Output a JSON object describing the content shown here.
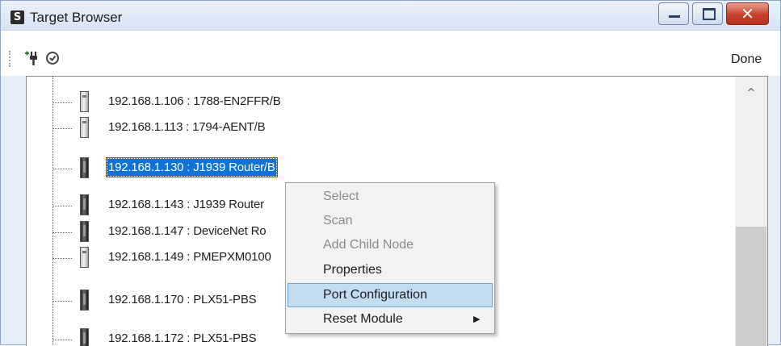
{
  "window": {
    "title": "Target Browser",
    "app_icon_glyph": "S",
    "close_glyph": "✕"
  },
  "toolbar": {
    "add_icon": "add-plug-icon",
    "refresh_icon": "refresh-icon",
    "done_label": "Done"
  },
  "tree": {
    "items": [
      {
        "label": "192.168.1.106 : 1788-EN2FFR/B",
        "icon": "light"
      },
      {
        "label": "192.168.1.113 : 1794-AENT/B",
        "icon": "light"
      },
      {
        "label": "192.168.1.130 : J1939 Router/B",
        "icon": "dark",
        "selected": true
      },
      {
        "label": "192.168.1.143 : J1939 Router",
        "icon": "dark"
      },
      {
        "label": "192.168.1.147 : DeviceNet Ro",
        "icon": "dark"
      },
      {
        "label": "192.168.1.149 : PMEPXM0100",
        "icon": "light"
      },
      {
        "label": "192.168.1.170 : PLX51-PBS",
        "icon": "dark"
      },
      {
        "label": "192.168.1.172 : PLX51-PBS",
        "icon": "dark"
      }
    ]
  },
  "scrollbar": {
    "up_arrow": "^"
  },
  "context_menu": {
    "items": [
      {
        "label": "Select",
        "enabled": false
      },
      {
        "label": "Scan",
        "enabled": false
      },
      {
        "label": "Add Child Node",
        "enabled": false
      },
      {
        "label": "Properties",
        "enabled": true
      },
      {
        "label": "Port Configuration",
        "enabled": true,
        "highlighted": true
      },
      {
        "label": "Reset Module",
        "enabled": true,
        "has_submenu": true
      }
    ],
    "submenu_arrow": "▶"
  }
}
